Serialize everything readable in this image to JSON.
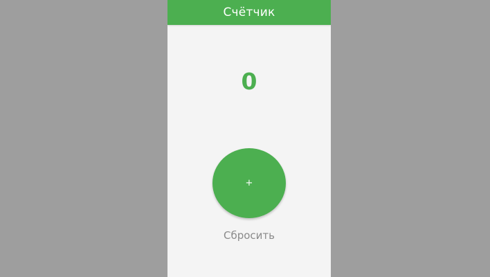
{
  "app_bar": {
    "title": "Счётчик",
    "color": "#4caf50"
  },
  "counter": {
    "value": "0",
    "color": "#4caf50"
  },
  "increment_button": {
    "icon": "plus-icon",
    "label": "+",
    "color": "#4caf50"
  },
  "reset_button": {
    "label": "Сбросить"
  }
}
